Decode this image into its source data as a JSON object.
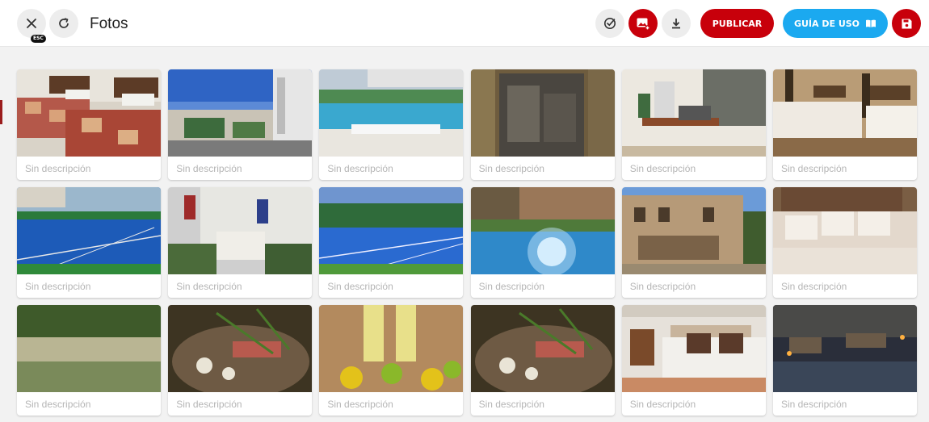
{
  "header": {
    "title": "Fotos",
    "esc_badge": "ESC",
    "publish_label": "PUBLICAR",
    "guide_label": "GUÍA DE USO",
    "icons": [
      "close-icon",
      "refresh-icon",
      "check-badge-icon",
      "add-image-icon",
      "download-icon",
      "book-icon",
      "save-icon"
    ]
  },
  "colors": {
    "primary_red": "#c8000b",
    "guide_blue": "#1ba9f0"
  },
  "photos": [
    {
      "caption": "Sin descripción",
      "subject": "hotel-bedroom-twin-beds"
    },
    {
      "caption": "Sin descripción",
      "subject": "building-exterior-palms"
    },
    {
      "caption": "Sin descripción",
      "subject": "pool-deck-loungers"
    },
    {
      "caption": "Sin descripción",
      "subject": "stone-wall-shower"
    },
    {
      "caption": "Sin descripción",
      "subject": "kitchenette"
    },
    {
      "caption": "Sin descripción",
      "subject": "twin-bedroom-white"
    },
    {
      "caption": "Sin descripción",
      "subject": "tennis-court"
    },
    {
      "caption": "Sin descripción",
      "subject": "hotel-entrance-flags"
    },
    {
      "caption": "Sin descripción",
      "subject": "tennis-court-palms"
    },
    {
      "caption": "Sin descripción",
      "subject": "pool-sunlight"
    },
    {
      "caption": "Sin descripción",
      "subject": "stone-villa-facade"
    },
    {
      "caption": "Sin descripción",
      "subject": "double-bed-pillows"
    },
    {
      "caption": "Sin descripción",
      "subject": "river-landscape"
    },
    {
      "caption": "Sin descripción",
      "subject": "gourmet-dish"
    },
    {
      "caption": "Sin descripción",
      "subject": "cocktails-limes"
    },
    {
      "caption": "Sin descripción",
      "subject": "gourmet-dish"
    },
    {
      "caption": "Sin descripción",
      "subject": "suite-bedroom"
    },
    {
      "caption": "Sin descripción",
      "subject": "terrace-night-lounge"
    }
  ]
}
